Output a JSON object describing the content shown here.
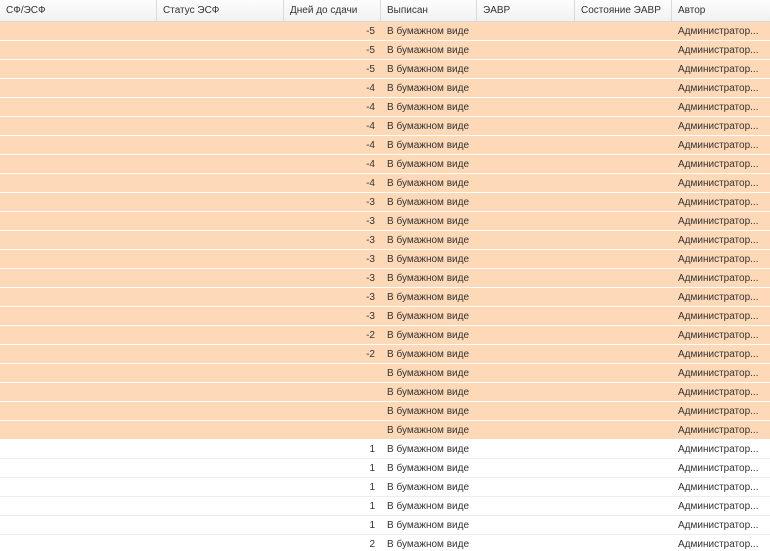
{
  "table": {
    "columns": [
      "СФ/ЭСФ",
      "Статус ЭСФ",
      "Дней до сдачи",
      "Выписан",
      "ЭАВР",
      "Состояние ЭАВР",
      "Автор"
    ],
    "highlight_color": "#fdd9b7",
    "rows": [
      {
        "sf": "",
        "status": "",
        "days": "-5",
        "issued": "В бумажном виде",
        "eavr": "",
        "eavr_state": "",
        "author": "Администратор...",
        "highlighted": true
      },
      {
        "sf": "",
        "status": "",
        "days": "-5",
        "issued": "В бумажном виде",
        "eavr": "",
        "eavr_state": "",
        "author": "Администратор...",
        "highlighted": true
      },
      {
        "sf": "",
        "status": "",
        "days": "-5",
        "issued": "В бумажном виде",
        "eavr": "",
        "eavr_state": "",
        "author": "Администратор...",
        "highlighted": true
      },
      {
        "sf": "",
        "status": "",
        "days": "-4",
        "issued": "В бумажном виде",
        "eavr": "",
        "eavr_state": "",
        "author": "Администратор...",
        "highlighted": true
      },
      {
        "sf": "",
        "status": "",
        "days": "-4",
        "issued": "В бумажном виде",
        "eavr": "",
        "eavr_state": "",
        "author": "Администратор...",
        "highlighted": true
      },
      {
        "sf": "",
        "status": "",
        "days": "-4",
        "issued": "В бумажном виде",
        "eavr": "",
        "eavr_state": "",
        "author": "Администратор...",
        "highlighted": true
      },
      {
        "sf": "",
        "status": "",
        "days": "-4",
        "issued": "В бумажном виде",
        "eavr": "",
        "eavr_state": "",
        "author": "Администратор...",
        "highlighted": true
      },
      {
        "sf": "",
        "status": "",
        "days": "-4",
        "issued": "В бумажном виде",
        "eavr": "",
        "eavr_state": "",
        "author": "Администратор...",
        "highlighted": true
      },
      {
        "sf": "",
        "status": "",
        "days": "-4",
        "issued": "В бумажном виде",
        "eavr": "",
        "eavr_state": "",
        "author": "Администратор...",
        "highlighted": true
      },
      {
        "sf": "",
        "status": "",
        "days": "-3",
        "issued": "В бумажном виде",
        "eavr": "",
        "eavr_state": "",
        "author": "Администратор...",
        "highlighted": true
      },
      {
        "sf": "",
        "status": "",
        "days": "-3",
        "issued": "В бумажном виде",
        "eavr": "",
        "eavr_state": "",
        "author": "Администратор...",
        "highlighted": true
      },
      {
        "sf": "",
        "status": "",
        "days": "-3",
        "issued": "В бумажном виде",
        "eavr": "",
        "eavr_state": "",
        "author": "Администратор...",
        "highlighted": true
      },
      {
        "sf": "",
        "status": "",
        "days": "-3",
        "issued": "В бумажном виде",
        "eavr": "",
        "eavr_state": "",
        "author": "Администратор...",
        "highlighted": true
      },
      {
        "sf": "",
        "status": "",
        "days": "-3",
        "issued": "В бумажном виде",
        "eavr": "",
        "eavr_state": "",
        "author": "Администратор...",
        "highlighted": true
      },
      {
        "sf": "",
        "status": "",
        "days": "-3",
        "issued": "В бумажном виде",
        "eavr": "",
        "eavr_state": "",
        "author": "Администратор...",
        "highlighted": true
      },
      {
        "sf": "",
        "status": "",
        "days": "-3",
        "issued": "В бумажном виде",
        "eavr": "",
        "eavr_state": "",
        "author": "Администратор...",
        "highlighted": true
      },
      {
        "sf": "",
        "status": "",
        "days": "-2",
        "issued": "В бумажном виде",
        "eavr": "",
        "eavr_state": "",
        "author": "Администратор...",
        "highlighted": true
      },
      {
        "sf": "",
        "status": "",
        "days": "-2",
        "issued": "В бумажном виде",
        "eavr": "",
        "eavr_state": "",
        "author": "Администратор...",
        "highlighted": true
      },
      {
        "sf": "",
        "status": "",
        "days": "",
        "issued": "В бумажном виде",
        "eavr": "",
        "eavr_state": "",
        "author": "Администратор...",
        "highlighted": true
      },
      {
        "sf": "",
        "status": "",
        "days": "",
        "issued": "В бумажном виде",
        "eavr": "",
        "eavr_state": "",
        "author": "Администратор...",
        "highlighted": true
      },
      {
        "sf": "",
        "status": "",
        "days": "",
        "issued": "В бумажном виде",
        "eavr": "",
        "eavr_state": "",
        "author": "Администратор...",
        "highlighted": true
      },
      {
        "sf": "",
        "status": "",
        "days": "",
        "issued": "В бумажном виде",
        "eavr": "",
        "eavr_state": "",
        "author": "Администратор...",
        "highlighted": true
      },
      {
        "sf": "",
        "status": "",
        "days": "1",
        "issued": "В бумажном виде",
        "eavr": "",
        "eavr_state": "",
        "author": "Администратор...",
        "highlighted": false
      },
      {
        "sf": "",
        "status": "",
        "days": "1",
        "issued": "В бумажном виде",
        "eavr": "",
        "eavr_state": "",
        "author": "Администратор...",
        "highlighted": false
      },
      {
        "sf": "",
        "status": "",
        "days": "1",
        "issued": "В бумажном виде",
        "eavr": "",
        "eavr_state": "",
        "author": "Администратор...",
        "highlighted": false
      },
      {
        "sf": "",
        "status": "",
        "days": "1",
        "issued": "В бумажном виде",
        "eavr": "",
        "eavr_state": "",
        "author": "Администратор...",
        "highlighted": false
      },
      {
        "sf": "",
        "status": "",
        "days": "1",
        "issued": "В бумажном виде",
        "eavr": "",
        "eavr_state": "",
        "author": "Администратор...",
        "highlighted": false
      },
      {
        "sf": "",
        "status": "",
        "days": "2",
        "issued": "В бумажном виде",
        "eavr": "",
        "eavr_state": "",
        "author": "Администратор...",
        "highlighted": false
      }
    ]
  }
}
